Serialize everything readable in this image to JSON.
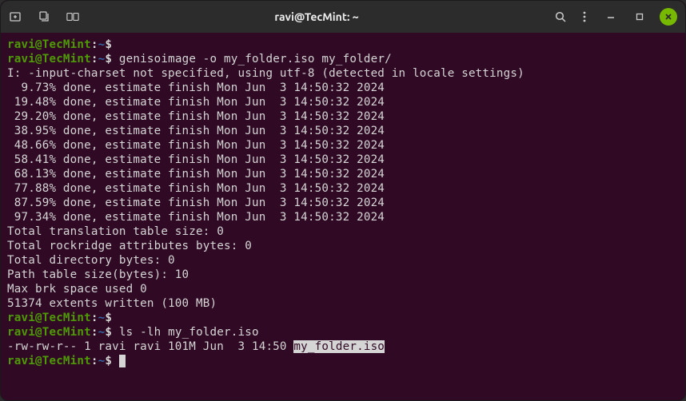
{
  "titlebar": {
    "title": "ravi@TecMint: ~",
    "icons": {
      "new_tab": "new-tab",
      "new_window": "new-window",
      "split": "split"
    }
  },
  "prompt": {
    "userhost": "ravi@TecMint",
    "path": "~",
    "symbol": "$"
  },
  "lines": {
    "cmd1": "",
    "cmd2": "genisoimage -o my_folder.iso my_folder/",
    "out1": "I: -input-charset not specified, using utf-8 (detected in locale settings)",
    "out2": "  9.73% done, estimate finish Mon Jun  3 14:50:32 2024",
    "out3": " 19.48% done, estimate finish Mon Jun  3 14:50:32 2024",
    "out4": " 29.20% done, estimate finish Mon Jun  3 14:50:32 2024",
    "out5": " 38.95% done, estimate finish Mon Jun  3 14:50:32 2024",
    "out6": " 48.66% done, estimate finish Mon Jun  3 14:50:32 2024",
    "out7": " 58.41% done, estimate finish Mon Jun  3 14:50:32 2024",
    "out8": " 68.13% done, estimate finish Mon Jun  3 14:50:32 2024",
    "out9": " 77.88% done, estimate finish Mon Jun  3 14:50:32 2024",
    "out10": " 87.59% done, estimate finish Mon Jun  3 14:50:32 2024",
    "out11": " 97.34% done, estimate finish Mon Jun  3 14:50:32 2024",
    "out12": "Total translation table size: 0",
    "out13": "Total rockridge attributes bytes: 0",
    "out14": "Total directory bytes: 0",
    "out15": "Path table size(bytes): 10",
    "out16": "Max brk space used 0",
    "out17": "51374 extents written (100 MB)",
    "cmd3": "",
    "cmd4": "ls -lh my_folder.iso",
    "ls_prefix": "-rw-rw-r-- 1 ravi ravi 101M Jun  3 14:50 ",
    "ls_file": "my_folder.iso",
    "cmd5": ""
  }
}
